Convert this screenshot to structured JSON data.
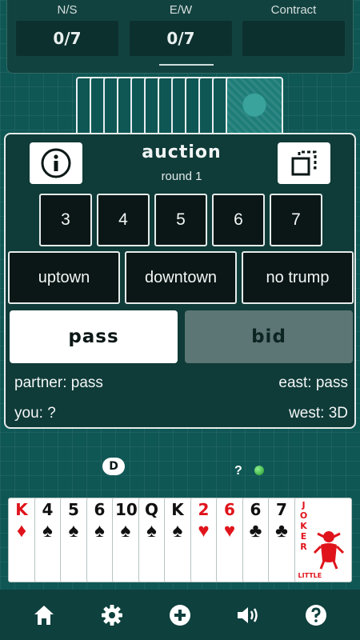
{
  "score": {
    "ns_label": "N/S",
    "ns_value": "0/7",
    "ew_label": "E/W",
    "ew_value": "0/7",
    "contract_label": "Contract",
    "contract_value": ""
  },
  "auction": {
    "title": "auction",
    "round": "round 1",
    "levels": [
      "3",
      "4",
      "5",
      "6",
      "7"
    ],
    "modes": [
      "uptown",
      "downtown",
      "no trump"
    ],
    "pass_label": "pass",
    "bid_label": "bid",
    "partner_status": "partner: pass",
    "east_status": "east: pass",
    "you_status": "you: ?",
    "west_status": "west: 3D",
    "info_icon": "info-icon",
    "layout_icon": "copy-icon"
  },
  "table": {
    "dealer_marker": "D",
    "unknown_marker": "?",
    "turn_color": "#2fbf3a"
  },
  "hand": [
    {
      "rank": "K",
      "suit": "♦",
      "color": "red"
    },
    {
      "rank": "4",
      "suit": "♠",
      "color": "black"
    },
    {
      "rank": "5",
      "suit": "♠",
      "color": "black"
    },
    {
      "rank": "6",
      "suit": "♠",
      "color": "black"
    },
    {
      "rank": "10",
      "suit": "♠",
      "color": "black"
    },
    {
      "rank": "Q",
      "suit": "♠",
      "color": "black"
    },
    {
      "rank": "K",
      "suit": "♠",
      "color": "black"
    },
    {
      "rank": "2",
      "suit": "♥",
      "color": "red"
    },
    {
      "rank": "6",
      "suit": "♥",
      "color": "red"
    },
    {
      "rank": "6",
      "suit": "♣",
      "color": "black"
    },
    {
      "rank": "7",
      "suit": "♣",
      "color": "black"
    },
    {
      "rank": "JOKER",
      "sub": "LITTLE",
      "color": "red"
    }
  ],
  "partner_cards_face_down": 12,
  "toolbar": {
    "icons": [
      "home-icon",
      "gear-icon",
      "plus-icon",
      "volume-icon",
      "help-icon"
    ]
  },
  "colors": {
    "felt": "#0f5755",
    "panel": "#0f3b38",
    "bid_disabled": "#5b7674"
  }
}
